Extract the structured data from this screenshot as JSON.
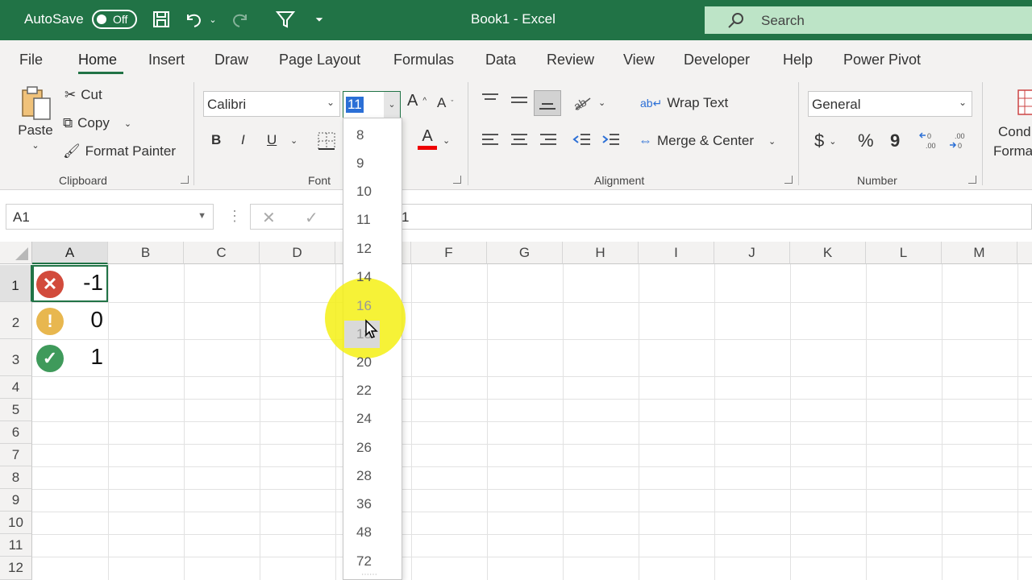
{
  "titlebar": {
    "autosave_label": "AutoSave",
    "autosave_state": "Off",
    "doc_title": "Book1  -  Excel",
    "search_label": "Search"
  },
  "tabs": [
    "File",
    "Home",
    "Insert",
    "Draw",
    "Page Layout",
    "Formulas",
    "Data",
    "Review",
    "View",
    "Developer",
    "Help",
    "Power Pivot"
  ],
  "active_tab": "Home",
  "ribbon": {
    "clipboard": {
      "paste": "Paste",
      "cut": "Cut",
      "copy": "Copy",
      "format_painter": "Format Painter",
      "label": "Clipboard"
    },
    "font": {
      "name": "Calibri",
      "size": "11",
      "bold": "B",
      "italic": "I",
      "underline": "U",
      "font_color_letter": "A",
      "label": "Font"
    },
    "alignment": {
      "wrap_text": "Wrap Text",
      "merge_center": "Merge & Center",
      "label": "Alignment"
    },
    "number": {
      "format": "General",
      "currency": "$",
      "percent": "%",
      "comma": "9",
      "label": "Number"
    },
    "styles": {
      "conditional_line1": "Cond",
      "conditional_line2": "Forma"
    }
  },
  "formula_bar": {
    "name_box": "A1",
    "content": "1"
  },
  "grid": {
    "columns": [
      "A",
      "B",
      "C",
      "D",
      "E",
      "F",
      "G",
      "H",
      "I",
      "J",
      "K",
      "L",
      "M"
    ],
    "rows": [
      "1",
      "2",
      "3",
      "4",
      "5",
      "6",
      "7",
      "8",
      "9",
      "10",
      "11",
      "12"
    ],
    "cells": [
      {
        "ref": "A1",
        "value": "-1",
        "icon": "red-x-icon"
      },
      {
        "ref": "A2",
        "value": "0",
        "icon": "yellow-exclamation-icon"
      },
      {
        "ref": "A3",
        "value": "1",
        "icon": "green-check-icon"
      }
    ]
  },
  "font_size_dropdown": [
    "8",
    "9",
    "10",
    "11",
    "12",
    "14",
    "16",
    "18",
    "20",
    "22",
    "24",
    "26",
    "28",
    "36",
    "48",
    "72"
  ],
  "hovered_size": "18",
  "colors": {
    "brand": "#217346",
    "red_icon": "#d24b3c",
    "yellow_icon": "#e8b74f",
    "green_icon": "#3f9a5b",
    "highlight": "#f5f014"
  }
}
